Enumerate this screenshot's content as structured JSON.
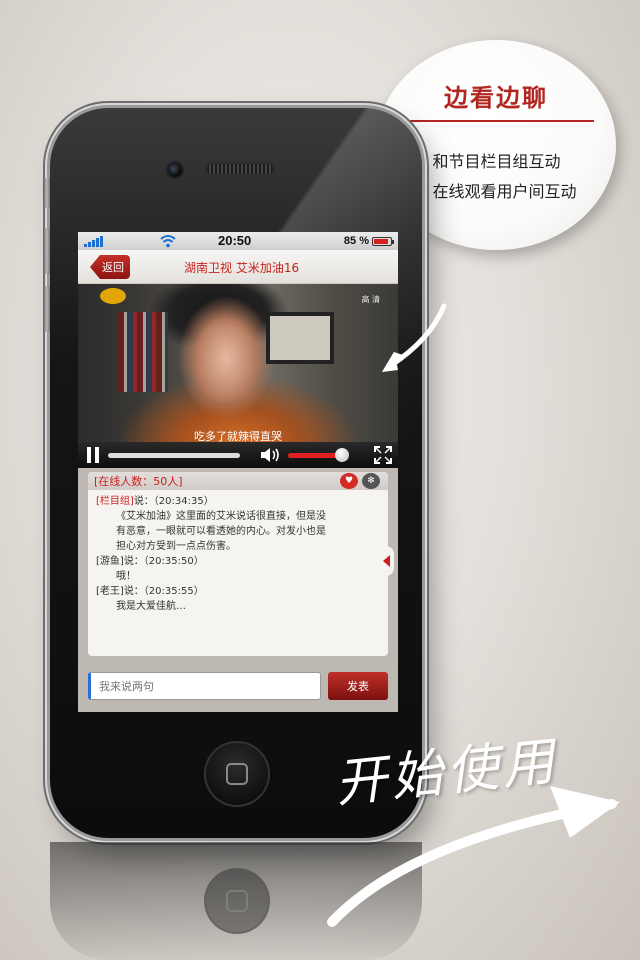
{
  "bubble": {
    "title": "边看边聊",
    "items": [
      "• 和节目栏目组互动",
      "• 在线观看用户间互动"
    ]
  },
  "status_bar": {
    "time": "20:50",
    "battery": "85 %"
  },
  "nav": {
    "back_label": "返回",
    "title": "湖南卫视 艾米加油16"
  },
  "video": {
    "quality_label": "高 清",
    "subtitle": "吃多了就辣得直哭",
    "volume_level": 0.9
  },
  "chat": {
    "online_label": "[在线人数：50人]",
    "messages": [
      {
        "sender": "[栏目组]",
        "meta": "说：（20:34:35）",
        "lines": [
          "《艾米加油》这里面的艾米说话很直接，但是没",
          "有恶意，一眼就可以看透她的内心。对发小也是",
          "担心对方受到一点点伤害。"
        ]
      },
      {
        "sender": "[游鱼]",
        "meta": "说：（20:35:50）",
        "lines": [
          "哦！"
        ]
      },
      {
        "sender": "[老王]",
        "meta": "说：（20:35:55）",
        "lines": [
          "我是大爱佳航…"
        ]
      }
    ],
    "input_placeholder": "我来说两句",
    "send_label": "发表"
  },
  "cta": {
    "start_label": "开始使用"
  },
  "colors": {
    "accent_red": "#c8201b",
    "bubble_red": "#b22520",
    "wifi_blue": "#1a6fd0"
  },
  "icons": [
    "signal-icon",
    "wifi-icon",
    "battery-icon",
    "pause-icon",
    "volume-icon",
    "fullscreen-icon",
    "heart-icon",
    "share-icon",
    "chevron-left-icon",
    "home-button-icon",
    "arrow-icon"
  ]
}
